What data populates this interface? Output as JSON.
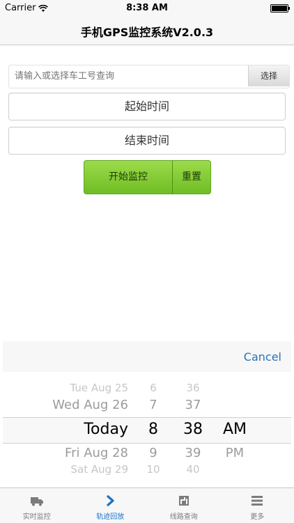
{
  "status_bar": {
    "carrier": "Carrier",
    "time": "8:38 AM"
  },
  "nav": {
    "title": "手机GPS监控系统V2.0.3"
  },
  "form": {
    "search_placeholder": "请输入或选择车工号查询",
    "select_button": "选择",
    "start_time_label": "起始时间",
    "end_time_label": "结束时间",
    "start_button": "开始监控",
    "reset_button": "重置"
  },
  "colors": {
    "accent_blue": "#1a73c9",
    "cancel_blue": "#2a72b5",
    "button_green_top": "#9cdb4a",
    "button_green_bottom": "#6fbd25"
  },
  "picker": {
    "cancel": "Cancel",
    "days": [
      "Tue Aug 25",
      "Wed Aug 26",
      "Today",
      "Fri Aug 28",
      "Sat Aug 29"
    ],
    "hours": [
      "6",
      "7",
      "8",
      "9",
      "10"
    ],
    "minutes": [
      "36",
      "37",
      "38",
      "39",
      "40"
    ],
    "ampm": [
      "AM",
      "PM"
    ],
    "selected": {
      "day": "Today",
      "hour": "8",
      "minute": "38",
      "ampm": "AM"
    }
  },
  "tabbar": {
    "items": [
      {
        "label": "实时监控",
        "icon": "truck-icon"
      },
      {
        "label": "轨迹回放",
        "icon": "chevron-right-icon",
        "active": true
      },
      {
        "label": "线路查询",
        "icon": "route-map-icon"
      },
      {
        "label": "更多",
        "icon": "menu-icon"
      }
    ]
  }
}
